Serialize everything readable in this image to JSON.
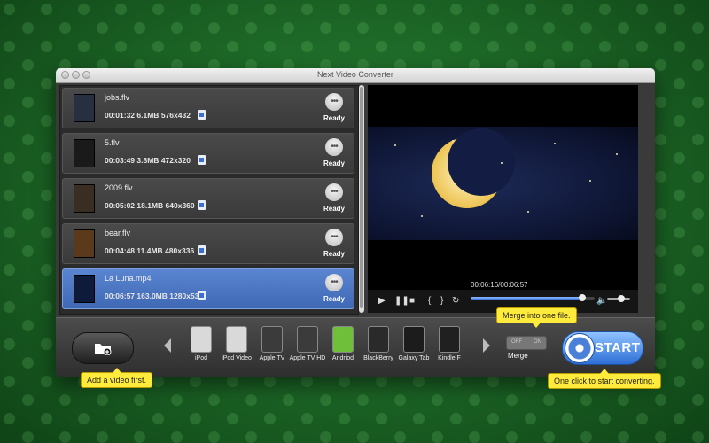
{
  "window": {
    "title": "Next Video Converter"
  },
  "files": [
    {
      "name": "jobs.flv",
      "duration": "00:01:32",
      "size": "6.1MB",
      "resolution": "576x432",
      "status": "Ready",
      "selected": false
    },
    {
      "name": "5.flv",
      "duration": "00:03:49",
      "size": "3.8MB",
      "resolution": "472x320",
      "status": "Ready",
      "selected": false
    },
    {
      "name": "2009.flv",
      "duration": "00:05:02",
      "size": "18.1MB",
      "resolution": "640x360",
      "status": "Ready",
      "selected": false
    },
    {
      "name": "bear.flv",
      "duration": "00:04:48",
      "size": "11.4MB",
      "resolution": "480x336",
      "status": "Ready",
      "selected": false
    },
    {
      "name": "La Luna.mp4",
      "duration": "00:06:57",
      "size": "163.0MB",
      "resolution": "1280x536",
      "status": "Ready",
      "selected": true
    }
  ],
  "player": {
    "time": "00:06:16/00:06:57",
    "progress": 0.9,
    "volume": 0.6
  },
  "devices": [
    {
      "label": "iPod",
      "icon": "ipod-icon"
    },
    {
      "label": "iPod Video",
      "icon": "ipod-video-icon"
    },
    {
      "label": "Apple TV",
      "icon": "apple-tv-icon"
    },
    {
      "label": "Apple TV HD",
      "icon": "apple-tv-hd-icon"
    },
    {
      "label": "Andriod",
      "icon": "android-icon"
    },
    {
      "label": "BlackBerry",
      "icon": "blackberry-icon"
    },
    {
      "label": "Galaxy Tab",
      "icon": "galaxy-tab-icon"
    },
    {
      "label": "Kindle F",
      "icon": "kindle-fire-icon"
    }
  ],
  "merge": {
    "label": "Merge",
    "off": "OFF",
    "on": "ON"
  },
  "start": {
    "label": "START"
  },
  "tips": {
    "add": "Add a video first.",
    "merge": "Merge into one file.",
    "start": "One click to start converting."
  },
  "colors": {
    "accent": "#3a74d9",
    "tooltip": "#ffeb3b",
    "background": "#1e6a28"
  }
}
